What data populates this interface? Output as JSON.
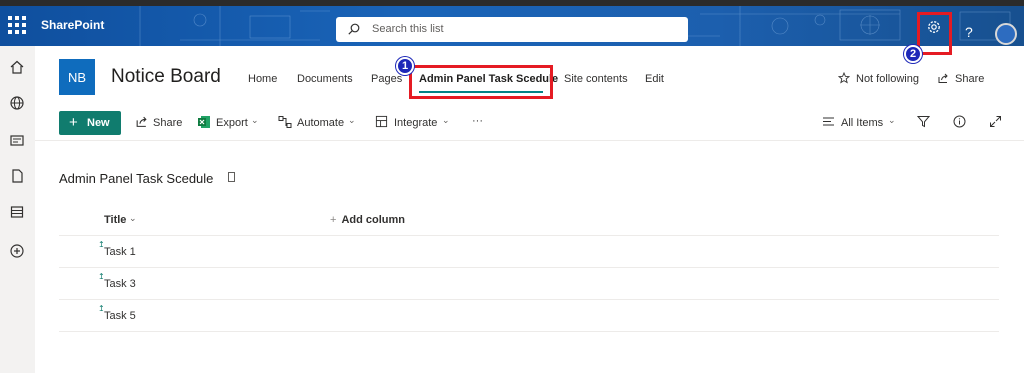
{
  "suite": {
    "brand": "SharePoint",
    "search_placeholder": "Search this list",
    "help_label": "?",
    "icons": [
      "waffle-icon",
      "search-icon",
      "gear-icon",
      "help-icon",
      "avatar"
    ]
  },
  "rail": {
    "icons": [
      "home-icon",
      "globe-icon",
      "news-icon",
      "file-icon",
      "list-icon",
      "add-icon"
    ]
  },
  "site": {
    "logo": "NB",
    "title": "Notice Board",
    "nav": [
      {
        "label": "Home"
      },
      {
        "label": "Documents"
      },
      {
        "label": "Pages"
      },
      {
        "label": "Admin Panel Task Scedule",
        "active": true
      },
      {
        "label": "Site contents"
      },
      {
        "label": "Edit"
      }
    ],
    "follow_label": "Not following",
    "share_label": "Share"
  },
  "annotations": {
    "badge_1": "1",
    "badge_2": "2",
    "highlight_color": "#e51b23",
    "badge_color": "#1d28b8"
  },
  "commands": {
    "new": "New",
    "share": "Share",
    "export": "Export",
    "automate": "Automate",
    "integrate": "Integrate",
    "more": "···",
    "view": "All Items"
  },
  "list": {
    "title": "Admin Panel Task Scedule",
    "columns": [
      "Title",
      "Add column"
    ],
    "rows": [
      "Task 1",
      "Task 3",
      "Task 5"
    ]
  },
  "colors": {
    "suitebar": "#1a64b8",
    "accent": "#107c6e",
    "logo": "#0f6cbd"
  }
}
